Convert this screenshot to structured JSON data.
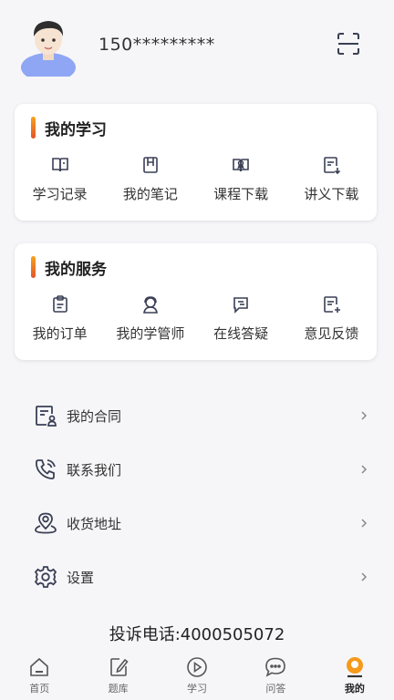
{
  "profile": {
    "phone": "150*********"
  },
  "study": {
    "title": "我的学习",
    "items": [
      {
        "label": "学习记录"
      },
      {
        "label": "我的笔记"
      },
      {
        "label": "课程下载"
      },
      {
        "label": "讲义下载"
      }
    ]
  },
  "service": {
    "title": "我的服务",
    "items": [
      {
        "label": "我的订单"
      },
      {
        "label": "我的学管师"
      },
      {
        "label": "在线答疑"
      },
      {
        "label": "意见反馈"
      }
    ]
  },
  "menu": [
    {
      "label": "我的合同"
    },
    {
      "label": "联系我们"
    },
    {
      "label": "收货地址"
    },
    {
      "label": "设置"
    }
  ],
  "complaint": "投诉电话:4000505072",
  "tabs": [
    {
      "label": "首页"
    },
    {
      "label": "题库"
    },
    {
      "label": "学习"
    },
    {
      "label": "问答"
    },
    {
      "label": "我的"
    }
  ],
  "colors": {
    "accent": "#f59a1b",
    "accent_dark": "#e2552a",
    "avatar_shirt": "#8fa6f4"
  }
}
